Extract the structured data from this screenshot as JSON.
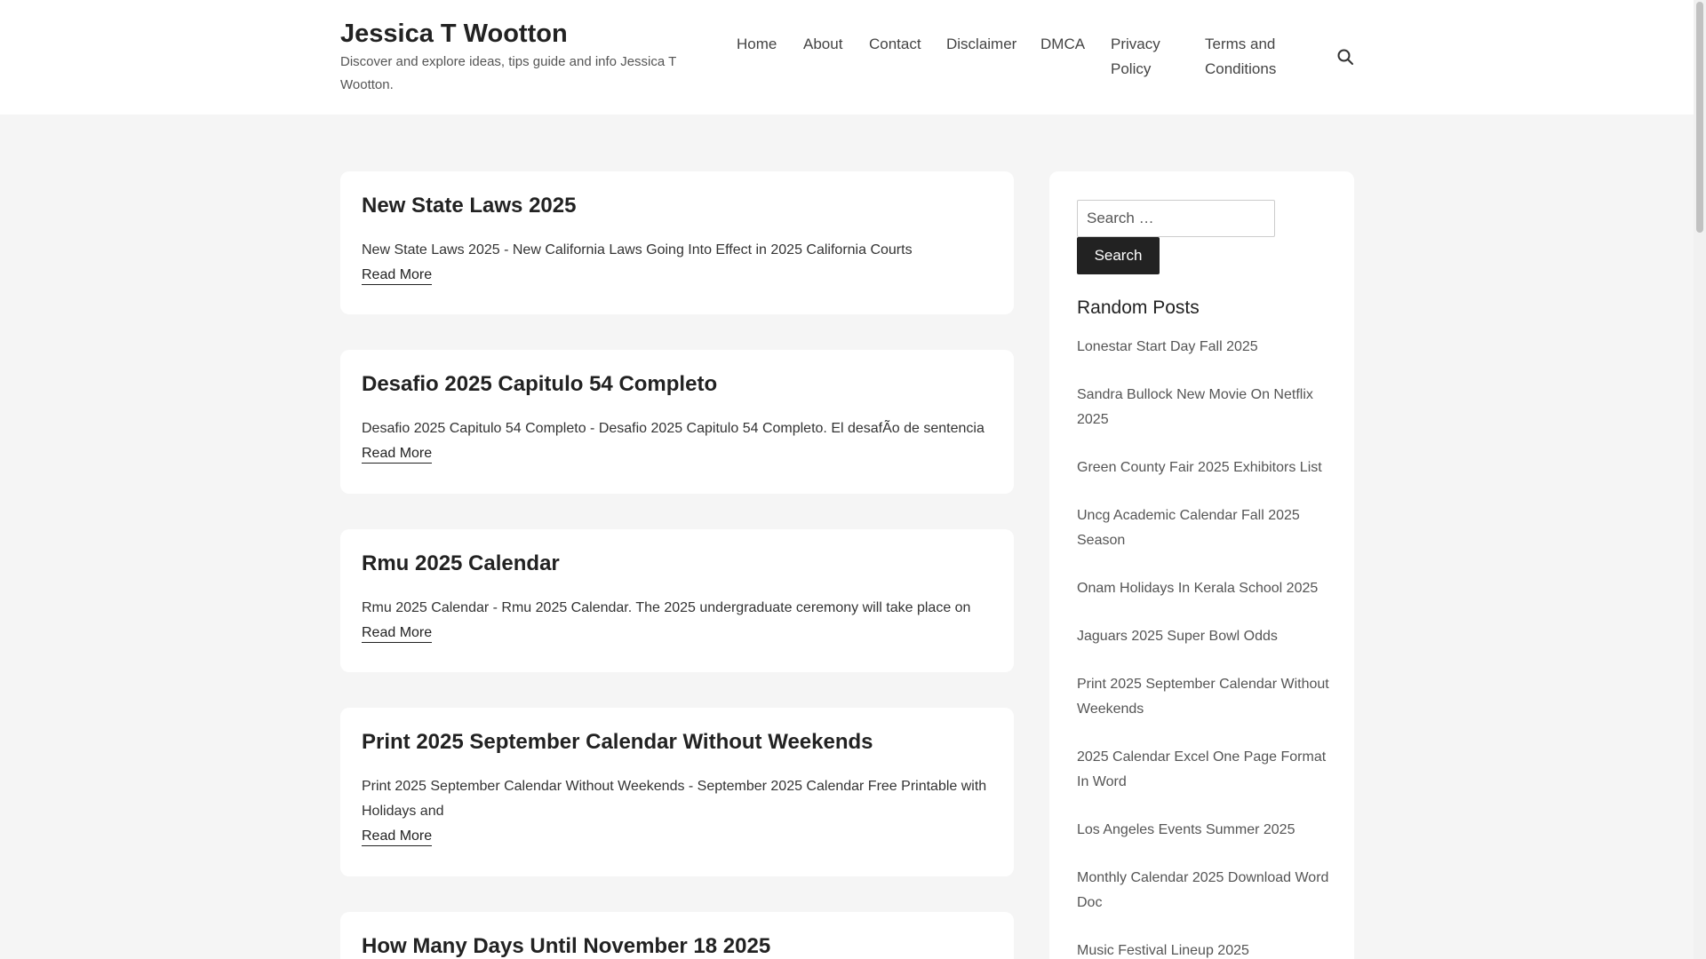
{
  "site": {
    "title": "Jessica T Wootton",
    "tagline": "Discover and explore ideas, tips guide and info Jessica T Wootton."
  },
  "nav": {
    "items": [
      {
        "label": "Home"
      },
      {
        "label": "About"
      },
      {
        "label": "Contact"
      },
      {
        "label": "Disclaimer"
      },
      {
        "label": "DMCA"
      },
      {
        "label": "Privacy Policy"
      },
      {
        "label": "Terms and Conditions"
      }
    ],
    "search_icon": "search-icon"
  },
  "posts": [
    {
      "title": "New State Laws 2025",
      "excerpt": "New State Laws 2025 - New California Laws Going Into Effect in 2025 California Courts",
      "read_more": "Read More"
    },
    {
      "title": "Desafio 2025 Capitulo 54 Completo",
      "excerpt": "Desafio 2025 Capitulo 54 Completo - Desafio 2025 Capitulo 54 Completo. El desafÃo de sentencia",
      "read_more": "Read More"
    },
    {
      "title": "Rmu 2025 Calendar",
      "excerpt": "Rmu 2025 Calendar - Rmu 2025 Calendar. The 2025 undergraduate ceremony will take place on",
      "read_more": "Read More"
    },
    {
      "title": "Print 2025 September Calendar Without Weekends",
      "excerpt": "Print 2025 September Calendar Without Weekends - September 2025 Calendar Free Printable with Holidays and",
      "read_more": "Read More"
    },
    {
      "title": "How Many Days Until November 18 2025"
    }
  ],
  "sidebar": {
    "search_placeholder": "Search …",
    "search_button": "Search",
    "random_title": "Random Posts",
    "random_posts": [
      "Lonestar Start Day Fall 2025",
      "Sandra Bullock New Movie On Netflix 2025",
      "Green County Fair 2025 Exhibitors List",
      "Uncg Academic Calendar Fall 2025 Season",
      "Onam Holidays In Kerala School 2025",
      "Jaguars 2025 Super Bowl Odds",
      "Print 2025 September Calendar Without Weekends",
      "2025 Calendar Excel One Page Format In Word",
      "Los Angeles Events Summer 2025",
      "Monthly Calendar 2025 Download Word Doc",
      "Music Festival Lineup 2025"
    ]
  }
}
